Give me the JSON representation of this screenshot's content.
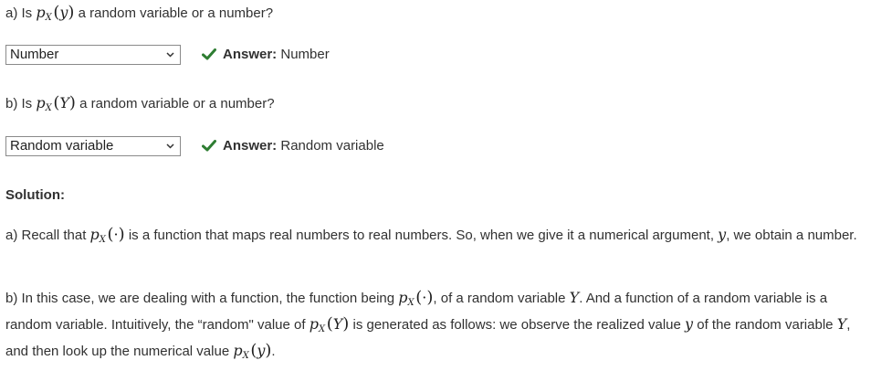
{
  "part_a": {
    "question_prefix": "a) Is",
    "question_suffix": "a random variable or a number?",
    "dropdown_value": "Number",
    "answer_label": "Answer:",
    "answer_value": "Number"
  },
  "part_b": {
    "question_prefix": "b) Is",
    "question_suffix": "a random variable or a number?",
    "dropdown_value": "Random variable",
    "answer_label": "Answer:",
    "answer_value": "Random variable"
  },
  "solution": {
    "heading": "Solution:",
    "a_text_1": "a) Recall that",
    "a_text_2": "is a function that maps real numbers to real numbers. So, when we give it a numerical argument,",
    "a_text_3": ", we obtain a number.",
    "b_text_1": "b) In this case, we are dealing with a function, the function being",
    "b_text_2": ", of a random variable",
    "b_text_3": ". And a function of a random variable is a random variable. Intuitively, the “random\" value of",
    "b_text_4": "is generated as follows: we observe the realized value",
    "b_text_5": "of the random variable",
    "b_text_6": ", and then look up the numerical value",
    "b_text_7": "."
  },
  "math": {
    "p": "p",
    "X": "X",
    "y_lower": "y",
    "Y_upper": "Y",
    "dot": "·",
    "lparen": "(",
    "rparen": ")"
  },
  "colors": {
    "check_green": "#2e7d32",
    "text": "#313131"
  }
}
